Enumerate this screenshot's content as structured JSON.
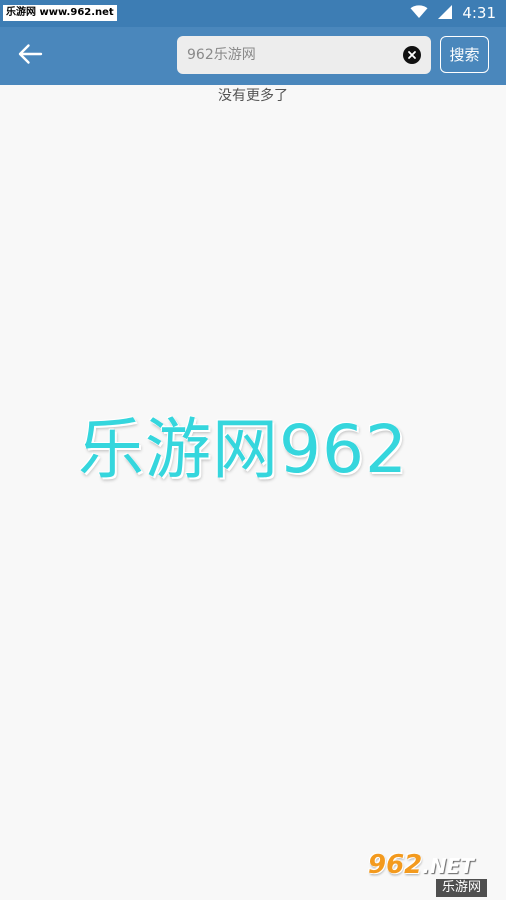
{
  "status_bar": {
    "watermark": "乐游网 www.962.net",
    "time": "4:31",
    "icons": [
      "wifi-icon",
      "cellular-signal-icon"
    ]
  },
  "app_bar": {
    "back_icon": "arrow-left-icon",
    "search": {
      "value": "",
      "placeholder": "962乐游网",
      "clear_icon": "clear-circle-x-icon"
    },
    "search_button_label": "搜索"
  },
  "content": {
    "no_more_text": "没有更多了",
    "center_watermark": "乐游网962"
  },
  "corner_logo": {
    "top": "962",
    "net": ".NET",
    "bottom": "乐游网"
  },
  "colors": {
    "status_bar": "#3d7db4",
    "app_bar": "#4a87bc",
    "watermark_cyan": "#35d6dd",
    "logo_orange": "#f39a1e"
  }
}
